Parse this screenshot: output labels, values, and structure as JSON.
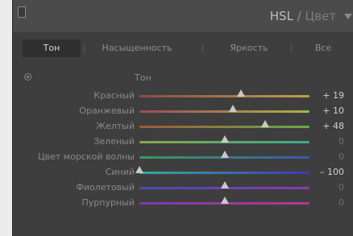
{
  "header": {
    "title_main": "HSL",
    "title_sep": " / ",
    "title_sub": "Цвет"
  },
  "tabs": [
    {
      "label": "Тон",
      "active": true
    },
    {
      "label": "Насыщенность",
      "active": false
    },
    {
      "label": "Яркость",
      "active": false
    },
    {
      "label": "Все",
      "active": false
    }
  ],
  "section": {
    "label": "Тон"
  },
  "sliders": [
    {
      "label": "Красный",
      "value": "+ 19",
      "level": 19,
      "colors": [
        "#8b4a4a",
        "#b8a14a"
      ]
    },
    {
      "label": "Оранжевый",
      "value": "+ 10",
      "level": 10,
      "colors": [
        "#a14a52",
        "#a8b44c"
      ]
    },
    {
      "label": "Желтый",
      "value": "+ 48",
      "level": 48,
      "colors": [
        "#a05a3a",
        "#6aa84a"
      ]
    },
    {
      "label": "Зеленый",
      "value": "0",
      "level": 0,
      "colors": [
        "#8aa84a",
        "#3aa88a"
      ]
    },
    {
      "label": "Цвет морской волны",
      "value": "0",
      "level": 0,
      "colors": [
        "#3a9a5a",
        "#3a5ab0"
      ]
    },
    {
      "label": "Синий",
      "value": "– 100",
      "level": -100,
      "colors": [
        "#3aa8a0",
        "#3a3ab8"
      ]
    },
    {
      "label": "Фиолетовый",
      "value": "0",
      "level": 0,
      "colors": [
        "#4a4ab8",
        "#8a3ab0"
      ]
    },
    {
      "label": "Пурпурный",
      "value": "0",
      "level": 0,
      "colors": [
        "#7a3ab0",
        "#b03a8a"
      ]
    }
  ]
}
